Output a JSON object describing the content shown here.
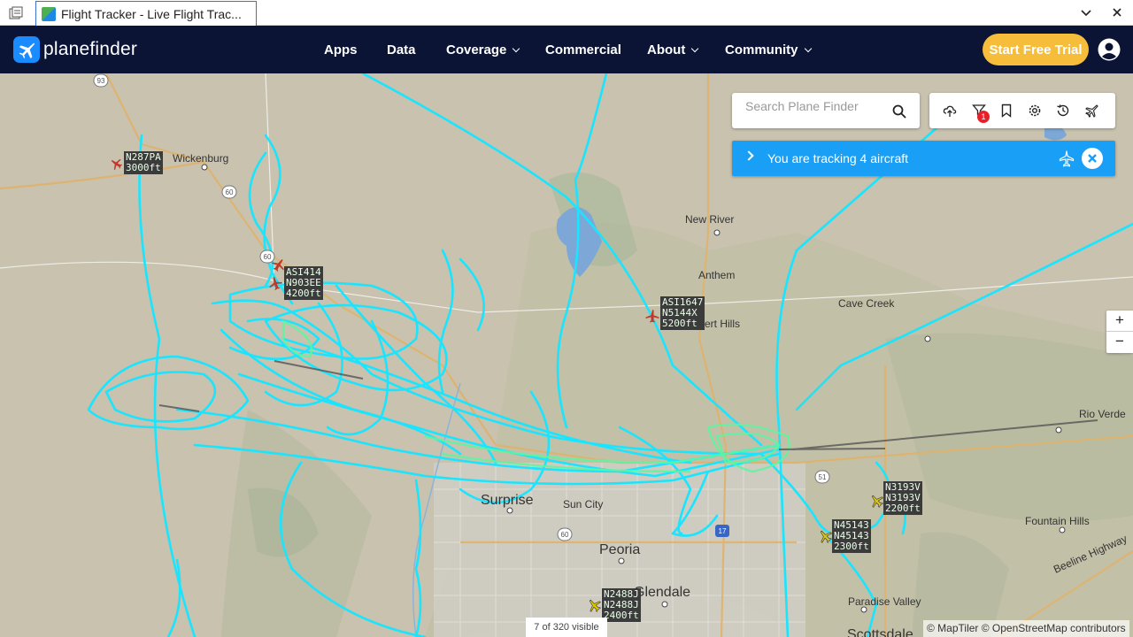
{
  "browser": {
    "tab_title": "Flight Tracker - Live Flight Trac..."
  },
  "header": {
    "logo_text": "planefinder",
    "nav": [
      {
        "label": "Apps",
        "dropdown": false
      },
      {
        "label": "Data",
        "dropdown": false
      },
      {
        "label": "Coverage",
        "dropdown": true
      },
      {
        "label": "Commercial",
        "dropdown": false
      },
      {
        "label": "About",
        "dropdown": true
      },
      {
        "label": "Community",
        "dropdown": true
      }
    ],
    "trial_label": "Start Free Trial"
  },
  "search": {
    "placeholder": "Search Plane Finder"
  },
  "toolbar": {
    "icons": [
      "cloud-upload-icon",
      "filter-icon",
      "bookmark-icon",
      "settings-icon",
      "history-icon",
      "airport-icon"
    ],
    "filter_badge": "1"
  },
  "tracking": {
    "text": "You are tracking 4 aircraft"
  },
  "zoom": {
    "in": "+",
    "out": "−"
  },
  "status": {
    "visible": "7 of 320 visible",
    "attribution": "© MapTiler © OpenStreetMap contributors"
  },
  "places": [
    {
      "id": "wickenburg",
      "label": "Wickenburg"
    },
    {
      "id": "new-river",
      "label": "New River"
    },
    {
      "id": "anthem",
      "label": "Anthem"
    },
    {
      "id": "cave-creek",
      "label": "Cave Creek"
    },
    {
      "id": "desert-hills",
      "label": "sert Hills"
    },
    {
      "id": "rio-verde",
      "label": "Rio Verde"
    },
    {
      "id": "surprise",
      "label": "Surprise"
    },
    {
      "id": "sun-city",
      "label": "Sun City"
    },
    {
      "id": "peoria",
      "label": "Peoria"
    },
    {
      "id": "glendale",
      "label": "Glendale"
    },
    {
      "id": "fountain-hills",
      "label": "Fountain Hills"
    },
    {
      "id": "paradise-valley",
      "label": "Paradise Valley"
    },
    {
      "id": "scottsdale",
      "label": "Scottsdale"
    },
    {
      "id": "beeline",
      "label": "Beeline Highway"
    }
  ],
  "route_shields": [
    "93",
    "60",
    "60",
    "51",
    "17",
    "60"
  ],
  "aircraft": [
    {
      "id": "n287pa",
      "label": "N287PA\n3000ft",
      "color": "#c0392b"
    },
    {
      "id": "asi414",
      "label": "ASI414\nN903EE\n4200ft",
      "color": "#c0392b"
    },
    {
      "id": "asi1647",
      "label": "ASI1647\nN5144X\n5200ft",
      "color": "#c0392b"
    },
    {
      "id": "n3193v",
      "label": "N3193V\nN3193V\n2200ft",
      "color": "#d8c200"
    },
    {
      "id": "n45143",
      "label": "N45143\nN45143\n2300ft",
      "color": "#d8c200"
    },
    {
      "id": "n2488j",
      "label": "N2488J\nN2488J\n2400ft",
      "color": "#d8c200"
    }
  ]
}
